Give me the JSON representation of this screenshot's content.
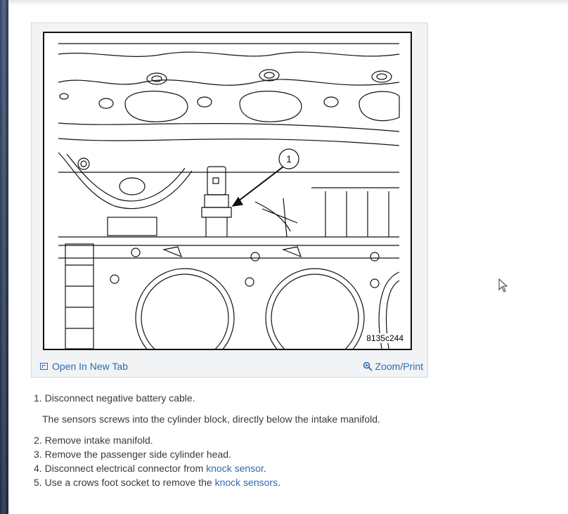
{
  "figure": {
    "code": "8135c244",
    "callout_number": "1",
    "open_tab_label": "Open In New Tab",
    "zoom_print_label": "Zoom/Print"
  },
  "steps": {
    "step1": {
      "num": "1.",
      "text": "Disconnect negative battery cable."
    },
    "note": "The sensors screws into the cylinder block, directly below the intake manifold.",
    "step2": {
      "num": "2.",
      "text": "Remove intake manifold."
    },
    "step3": {
      "num": "3.",
      "text": "Remove the passenger side cylinder head."
    },
    "step4": {
      "num": "4.",
      "text_before": "Disconnect electrical connector from ",
      "link": "knock sensor",
      "text_after": "."
    },
    "step5": {
      "num": "5.",
      "text_before": "Use a crows foot socket to remove the ",
      "link": "knock sensors",
      "text_after": "."
    }
  },
  "colors": {
    "link": "#2b6cb0",
    "text": "#3a3a3a",
    "card_bg": "#f2f3f5"
  },
  "icons": {
    "open_tab": "open-in-new-tab-icon",
    "zoom": "zoom-magnifier-icon",
    "cursor": "mouse-pointer-icon"
  }
}
